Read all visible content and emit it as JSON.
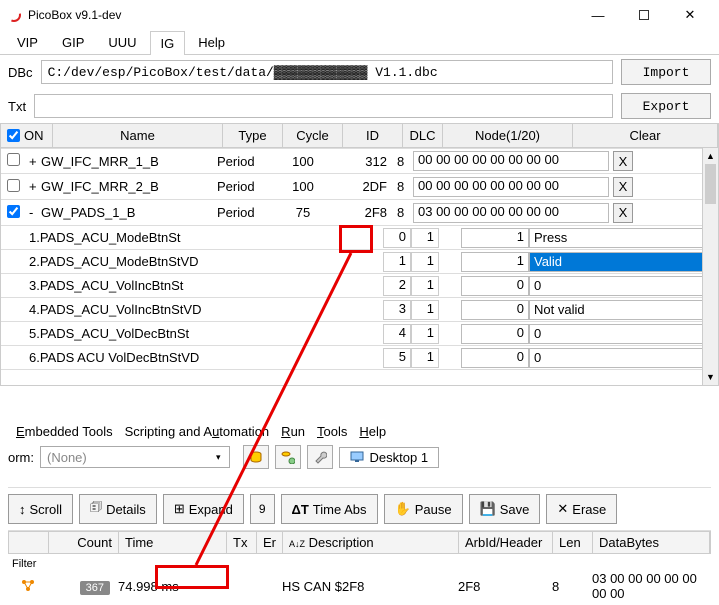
{
  "title": "PicoBox v9.1-dev",
  "tabs": [
    "VIP",
    "GIP",
    "UUU",
    "IG",
    "Help"
  ],
  "active_tab": 3,
  "dbc_label": "DBc",
  "dbc_path": "C:/dev/esp/PicoBox/test/data/▓▓▓▓▓▓▓▓▓▓▓▓ V1.1.dbc",
  "import_label": "Import",
  "txt_label": "Txt",
  "txt_path": "",
  "export_label": "Export",
  "on_label": "ON",
  "columns": {
    "name": "Name",
    "type": "Type",
    "cycle": "Cycle",
    "id": "ID",
    "dlc": "DLC",
    "node": "Node(1/20)",
    "clear": "Clear"
  },
  "messages": [
    {
      "chk": false,
      "exp": "+",
      "name": "GW_IFC_MRR_1_B",
      "type": "Period",
      "cycle": "100",
      "id": "312",
      "dlc": "8",
      "data": "00 00 00 00 00 00 00 00",
      "x": "X"
    },
    {
      "chk": false,
      "exp": "+",
      "name": "GW_IFC_MRR_2_B",
      "type": "Period",
      "cycle": "100",
      "id": "2DF",
      "dlc": "8",
      "data": "00 00 00 00 00 00 00 00",
      "x": "X"
    },
    {
      "chk": true,
      "exp": "-",
      "name": "GW_PADS_1_B",
      "type": "Period",
      "cycle": "75",
      "id": "2F8",
      "dlc": "8",
      "data": "03 00 00 00 00 00 00 00",
      "x": "X"
    }
  ],
  "signals": [
    {
      "n": "1.PADS_ACU_ModeBtnSt",
      "bit": "0",
      "len": "1",
      "val": "1",
      "desc": "Press"
    },
    {
      "n": "2.PADS_ACU_ModeBtnStVD",
      "bit": "1",
      "len": "1",
      "val": "1",
      "desc": "Valid",
      "sel": true
    },
    {
      "n": "3.PADS_ACU_VolIncBtnSt",
      "bit": "2",
      "len": "1",
      "val": "0",
      "desc": "0"
    },
    {
      "n": "4.PADS_ACU_VolIncBtnStVD",
      "bit": "3",
      "len": "1",
      "val": "0",
      "desc": "Not valid"
    },
    {
      "n": "5.PADS_ACU_VolDecBtnSt",
      "bit": "4",
      "len": "1",
      "val": "0",
      "desc": "0"
    },
    {
      "n": "6.PADS ACU VolDecBtnStVD",
      "bit": "5",
      "len": "1",
      "val": "0",
      "desc": "0"
    }
  ],
  "menu2": {
    "et": "Embedded Tools",
    "sa": "Scripting and Automation",
    "run": "Run",
    "tools": "Tools",
    "help": "Help"
  },
  "orm_label": "orm:",
  "orm_value": "(None)",
  "desktop_label": "Desktop 1",
  "toolbar2": {
    "scroll": "Scroll",
    "details": "Details",
    "expand": "Expand",
    "nine": "9",
    "timeabs": "Time Abs",
    "pause": "Pause",
    "save": "Save",
    "erase": "Erase"
  },
  "log_cols": {
    "count": "Count",
    "time": "Time",
    "tx": "Tx",
    "er": "Er",
    "desc": "Description",
    "arb": "ArbId/Header",
    "len": "Len",
    "data": "DataBytes"
  },
  "filter_label": "Filter",
  "log_row": {
    "count": "367",
    "time": "74.998 ms",
    "desc": "HS CAN $2F8",
    "arb": "2F8",
    "len": "8",
    "data": "03 00 00 00 00 00 00 00"
  },
  "icons": {
    "az": "A↓Z"
  }
}
